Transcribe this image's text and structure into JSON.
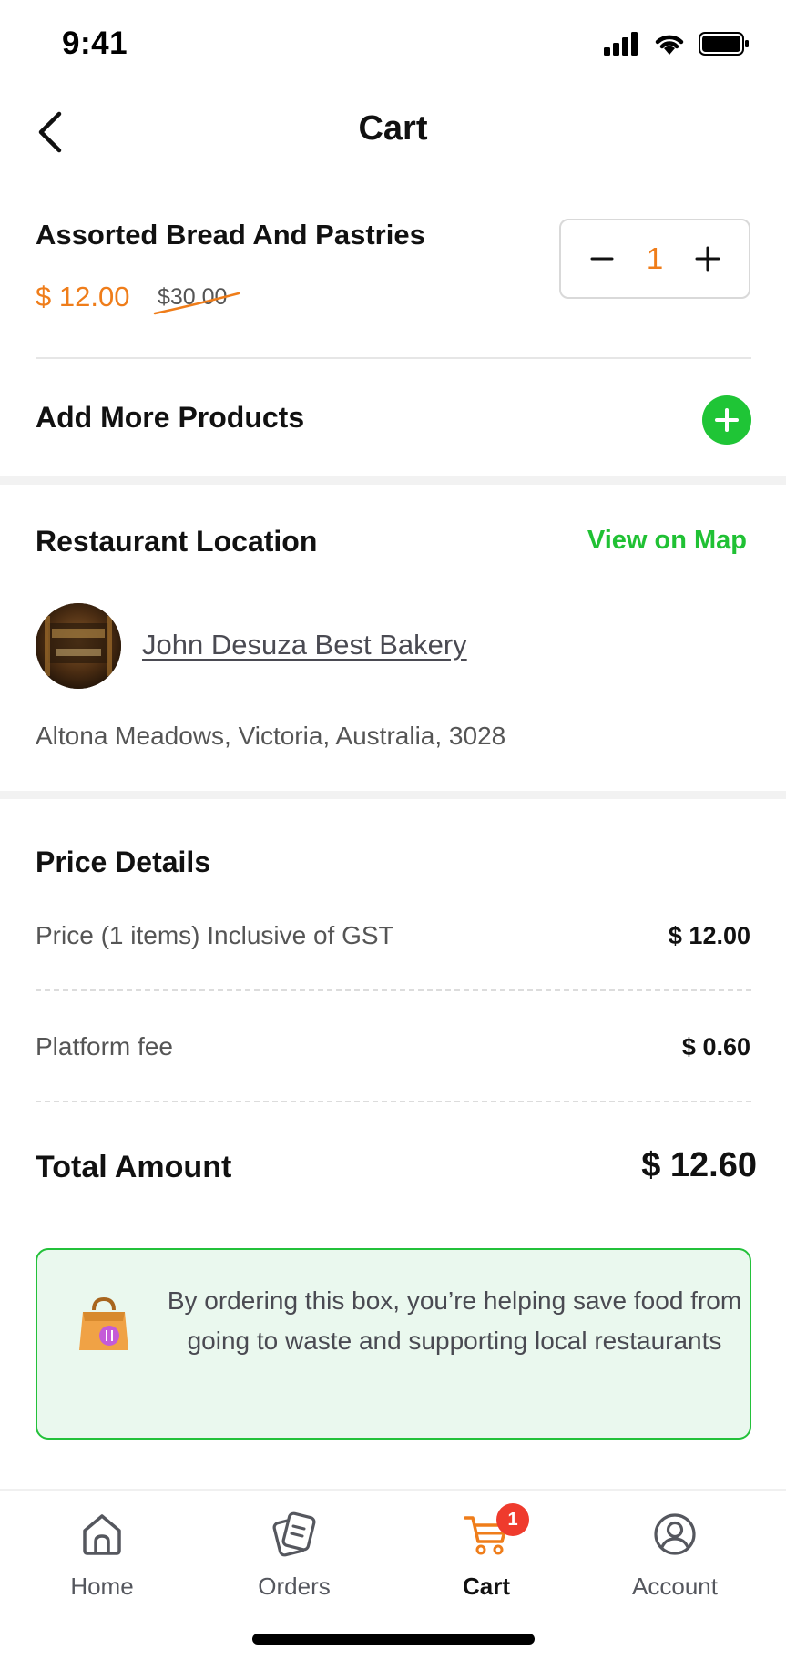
{
  "status_bar": {
    "time": "9:41",
    "icons": [
      "signal-icon",
      "wifi-icon",
      "battery-icon"
    ]
  },
  "header": {
    "title": "Cart",
    "back_icon": "chevron-left-icon"
  },
  "product": {
    "name": "Assorted Bread And Pastries",
    "price": "$ 12.00",
    "original_price": "$30.00",
    "quantity": "1"
  },
  "add_more": {
    "label": "Add More Products"
  },
  "location": {
    "title": "Restaurant Location",
    "view_map": "View on Map",
    "restaurant_name": "John Desuza Best Bakery",
    "address": "Altona Meadows, Victoria, Australia, 3028"
  },
  "price_details": {
    "title": "Price Details",
    "rows": [
      {
        "label": "Price (1 items) Inclusive of GST",
        "value": "$ 12.00"
      },
      {
        "label": "Platform fee",
        "value": "$ 0.60"
      }
    ],
    "total_label": "Total Amount",
    "total_value": "$ 12.60"
  },
  "info_message": "By ordering this box, you’re helping save food from going to waste and supporting local restaurants",
  "tabs": [
    {
      "label": "Home",
      "icon": "home-icon",
      "active": false
    },
    {
      "label": "Orders",
      "icon": "orders-icon",
      "active": false
    },
    {
      "label": "Cart",
      "icon": "cart-icon",
      "active": true,
      "badge": "1"
    },
    {
      "label": "Account",
      "icon": "account-icon",
      "active": false
    }
  ],
  "colors": {
    "accent_orange": "#ef7d1a",
    "accent_green": "#20c134",
    "badge_red": "#ef3b2d",
    "info_bg": "#eaf8ee"
  }
}
